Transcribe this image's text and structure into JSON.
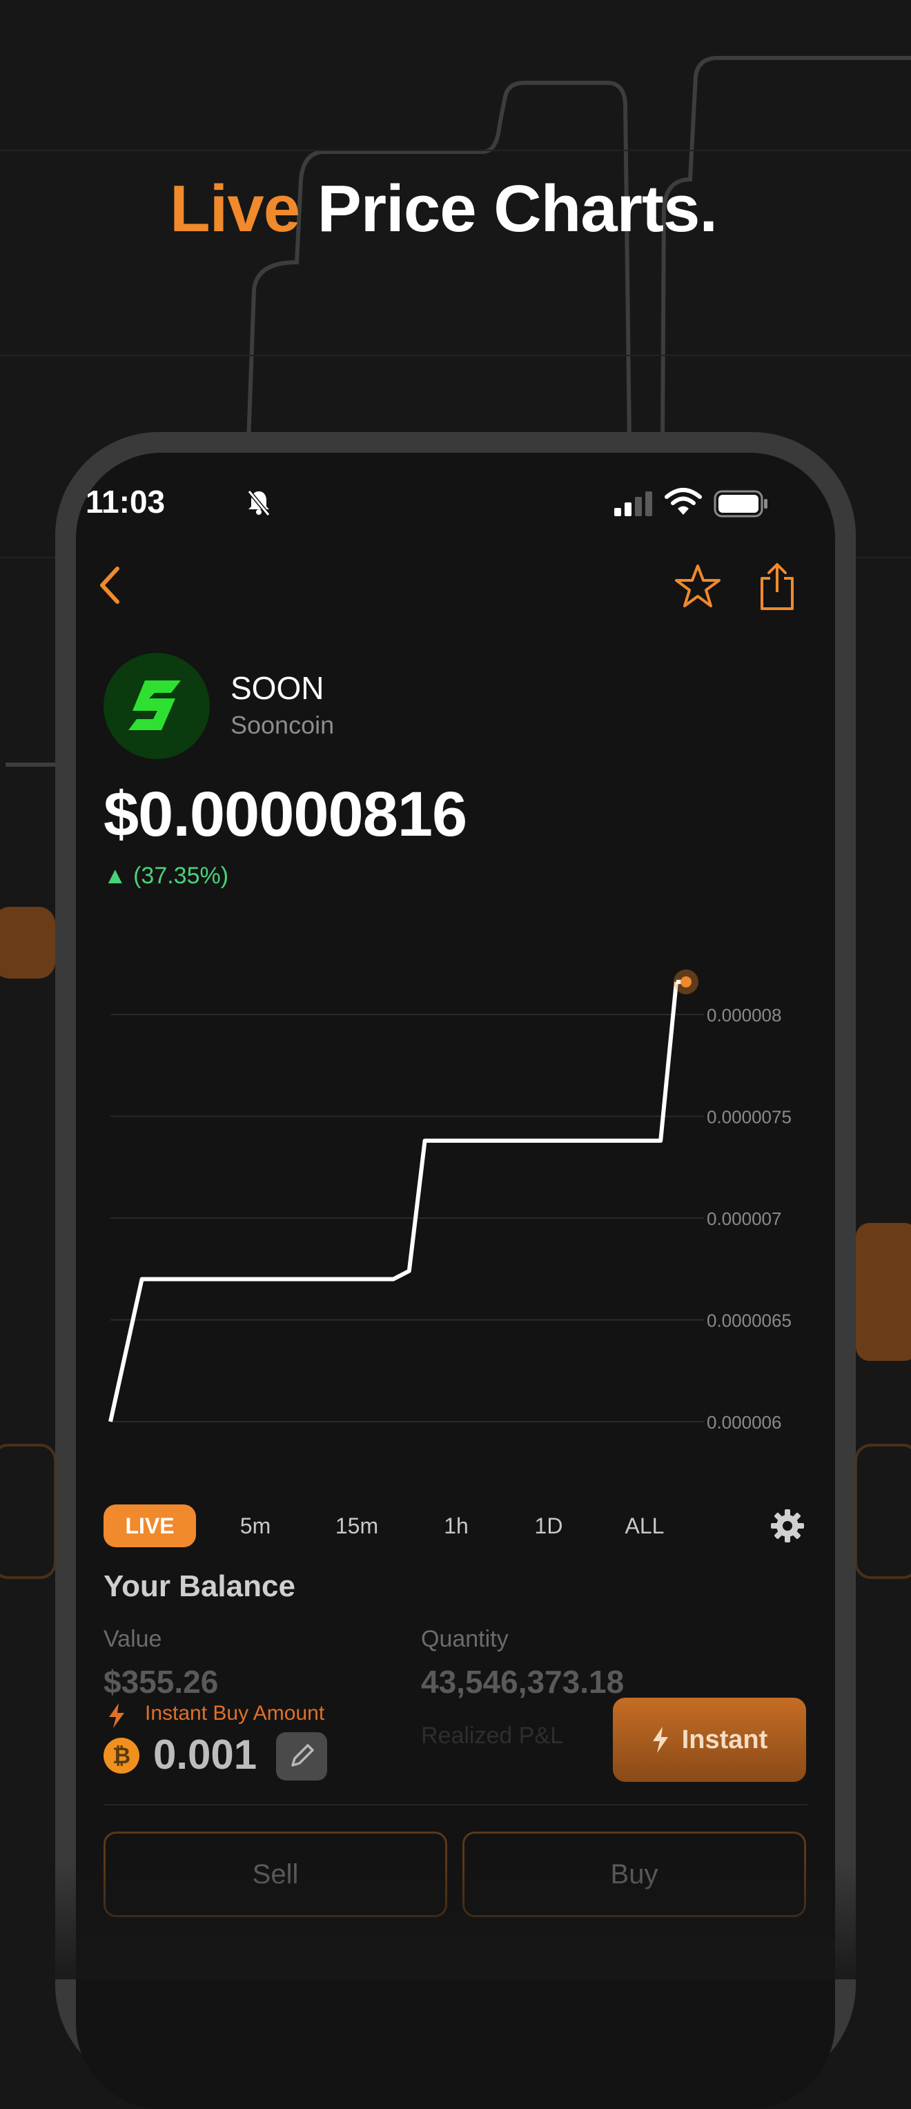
{
  "headline": {
    "accent": "Live",
    "rest": "Price Charts."
  },
  "status_bar": {
    "time": "11:03"
  },
  "coin": {
    "ticker": "SOON",
    "name": "Sooncoin",
    "price": "$0.00000816",
    "change": "▲ (37.35%)"
  },
  "chart_data": {
    "type": "line",
    "y_ticks": [
      "0.000008",
      "0.0000075",
      "0.000007",
      "0.0000065",
      "0.000006"
    ],
    "ylim": [
      6e-06,
      8.2e-06
    ],
    "x": [
      0,
      2,
      4,
      5,
      6,
      7,
      8,
      9,
      10,
      11,
      12,
      13,
      14,
      15,
      16,
      17,
      18,
      19,
      20,
      21,
      22,
      23,
      24,
      25,
      26,
      27,
      28,
      29,
      30,
      31,
      32,
      33,
      34,
      35,
      36
    ],
    "values": [
      6e-06,
      6.7e-06,
      6.7e-06,
      6.7e-06,
      6.7e-06,
      6.7e-06,
      6.7e-06,
      6.7e-06,
      6.7e-06,
      6.7e-06,
      6.7e-06,
      6.7e-06,
      6.7e-06,
      6.7e-06,
      6.7e-06,
      6.7e-06,
      6.7e-06,
      6.74e-06,
      7.38e-06,
      7.38e-06,
      7.38e-06,
      7.38e-06,
      7.38e-06,
      7.38e-06,
      7.38e-06,
      7.38e-06,
      7.38e-06,
      7.38e-06,
      7.38e-06,
      7.38e-06,
      7.38e-06,
      7.38e-06,
      7.38e-06,
      7.38e-06,
      8.16e-06
    ],
    "color": "#ffffff",
    "marker_color": "#f08a2c",
    "grid": true
  },
  "time_tabs": [
    "LIVE",
    "5m",
    "15m",
    "1h",
    "1D",
    "ALL"
  ],
  "balance": {
    "title": "Your Balance",
    "value_label": "Value",
    "value": "$355.26",
    "quantity_label": "Quantity",
    "quantity": "43,546,373.18",
    "realized_label": "Realized P&L"
  },
  "instant_buy": {
    "label": "Instant Buy Amount",
    "amount": "0.001",
    "button": "Instant",
    "coin_symbol": "₿"
  },
  "actions": {
    "sell": "Sell",
    "buy": "Buy"
  },
  "colors": {
    "accent": "#f08a2c",
    "positive": "#49d17a",
    "background": "#131313"
  }
}
